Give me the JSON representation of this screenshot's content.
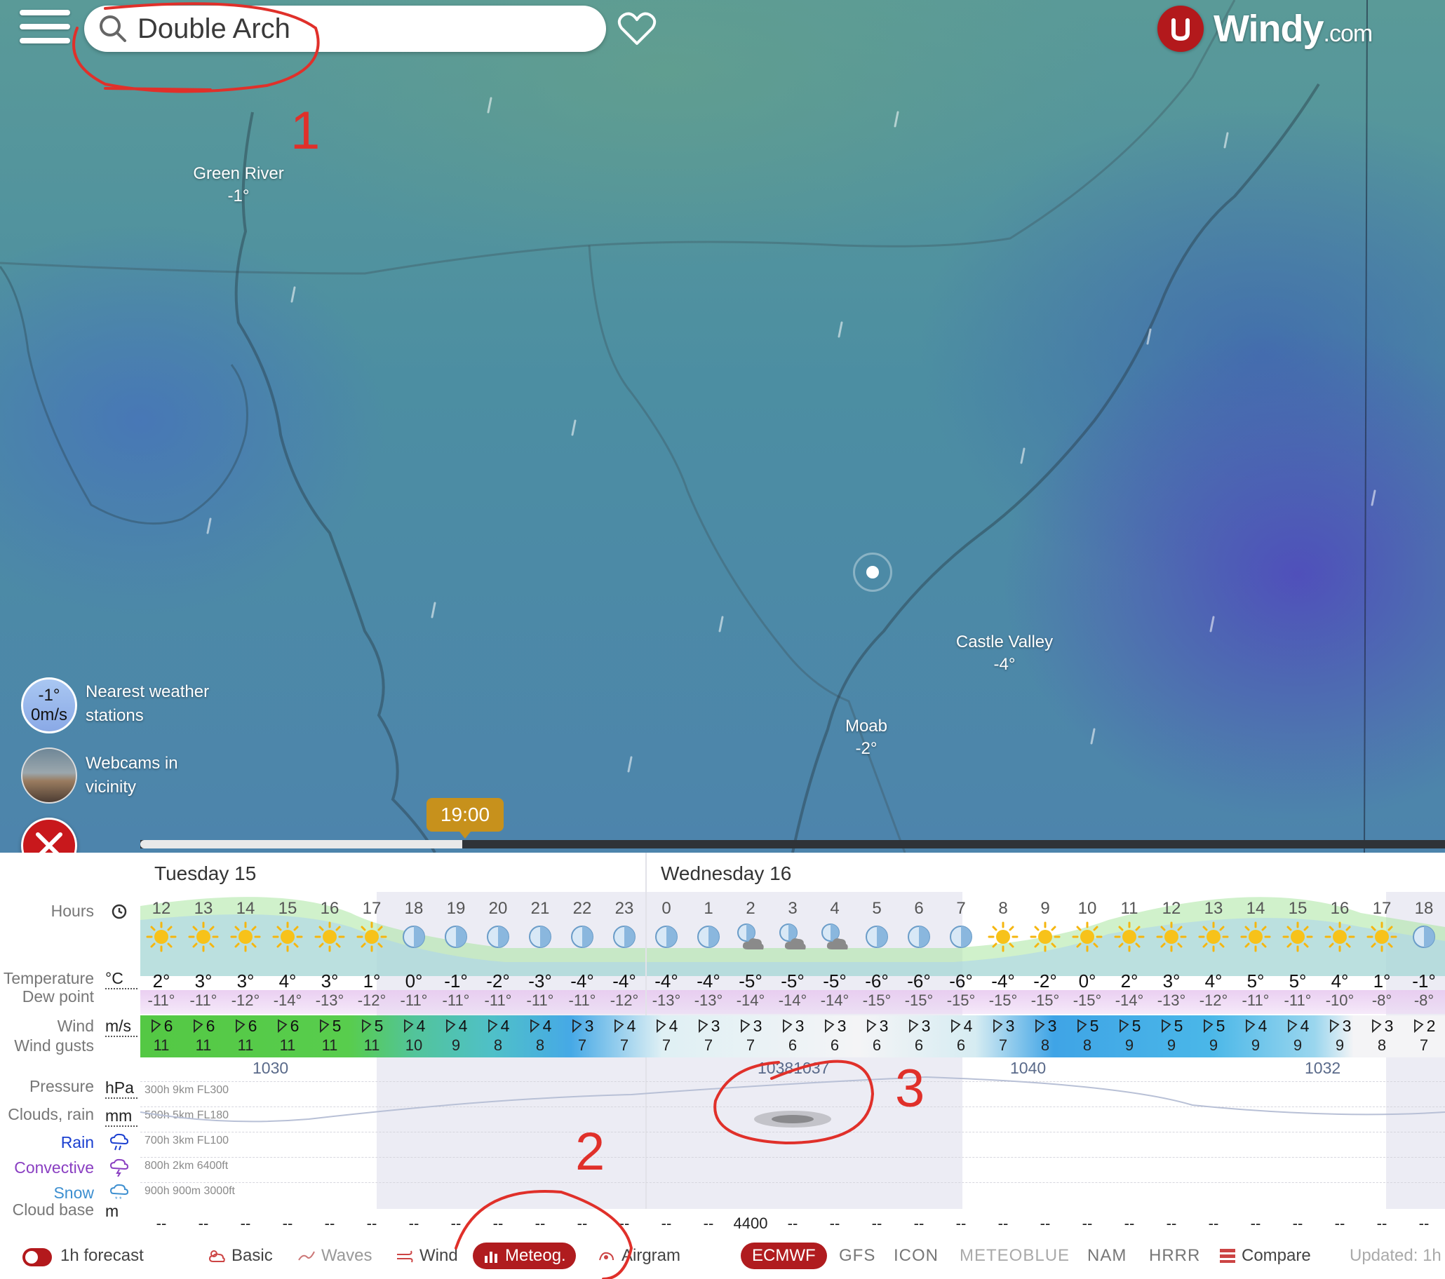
{
  "search": {
    "value": "Double Arch"
  },
  "logo": {
    "brand": "Windy",
    "suffix": ".com"
  },
  "map": {
    "places": [
      {
        "name": "Green River",
        "temp": "-1°"
      },
      {
        "name": "Castle Valley",
        "temp": "-4°"
      },
      {
        "name": "Moab",
        "temp": "-2°"
      }
    ],
    "station": {
      "temp": "-1°",
      "wind": "0m/s",
      "label_line1": "Nearest weather",
      "label_line2": "stations"
    },
    "webcams": {
      "label_line1": "Webcams in",
      "label_line2": "vicinity"
    },
    "timeline": {
      "current_time": "19:00",
      "progress": 0.247
    }
  },
  "forecast": {
    "days": [
      "Tuesday 15",
      "Wednesday 16"
    ],
    "row_labels": {
      "hours": "Hours",
      "temperature": "Temperature",
      "temperature_unit": "°C",
      "dew_point": "Dew point",
      "wind": "Wind",
      "wind_unit": "m/s",
      "wind_gusts": "Wind gusts",
      "pressure": "Pressure",
      "pressure_unit": "hPa",
      "clouds": "Clouds, rain",
      "clouds_unit": "mm",
      "rain": "Rain",
      "convective": "Convective",
      "snow": "Snow",
      "cloud_base": "Cloud base",
      "cloud_base_unit": "m"
    },
    "row_colors": {
      "rain": "#1a3fd0",
      "convective": "#8a3fc2",
      "snow": "#3d8fd0"
    },
    "hours": [
      "12",
      "13",
      "14",
      "15",
      "16",
      "17",
      "18",
      "19",
      "20",
      "21",
      "22",
      "23",
      "0",
      "1",
      "2",
      "3",
      "4",
      "5",
      "6",
      "7",
      "8",
      "9",
      "10",
      "11",
      "12",
      "13",
      "14",
      "15",
      "16",
      "17",
      "18"
    ],
    "icons": [
      "sun-icon",
      "sun-icon",
      "sun-icon",
      "sun-icon",
      "sun-icon",
      "sun-icon",
      "moon-icon",
      "moon-icon",
      "moon-icon",
      "moon-icon",
      "moon-icon",
      "moon-icon",
      "moon-icon",
      "moon-icon",
      "moon-cloud-icon",
      "moon-cloud-icon",
      "moon-cloud-icon",
      "moon-icon",
      "moon-icon",
      "moon-icon",
      "sun-icon",
      "sun-icon",
      "sun-icon",
      "sun-icon",
      "sun-icon",
      "sun-icon",
      "sun-icon",
      "sun-icon",
      "sun-icon",
      "sun-icon",
      "moon-icon"
    ],
    "temperatures": [
      "2°",
      "3°",
      "3°",
      "4°",
      "3°",
      "1°",
      "0°",
      "-1°",
      "-2°",
      "-3°",
      "-4°",
      "-4°",
      "-4°",
      "-4°",
      "-5°",
      "-5°",
      "-5°",
      "-6°",
      "-6°",
      "-6°",
      "-4°",
      "-2°",
      "0°",
      "2°",
      "3°",
      "4°",
      "5°",
      "5°",
      "4°",
      "1°",
      "-1°"
    ],
    "dew_points": [
      "-11°",
      "-11°",
      "-12°",
      "-14°",
      "-13°",
      "-12°",
      "-11°",
      "-11°",
      "-11°",
      "-11°",
      "-11°",
      "-12°",
      "-13°",
      "-13°",
      "-14°",
      "-14°",
      "-14°",
      "-15°",
      "-15°",
      "-15°",
      "-15°",
      "-15°",
      "-15°",
      "-14°",
      "-13°",
      "-12°",
      "-11°",
      "-11°",
      "-10°",
      "-8°",
      "-8°"
    ],
    "wind_speeds": [
      "6",
      "6",
      "6",
      "6",
      "5",
      "5",
      "4",
      "4",
      "4",
      "4",
      "3",
      "4",
      "4",
      "3",
      "3",
      "3",
      "3",
      "3",
      "3",
      "4",
      "3",
      "3",
      "5",
      "5",
      "5",
      "5",
      "4",
      "4",
      "3",
      "3",
      "2"
    ],
    "wind_gusts": [
      "11",
      "11",
      "11",
      "11",
      "11",
      "11",
      "10",
      "9",
      "8",
      "8",
      "7",
      "7",
      "7",
      "7",
      "7",
      "6",
      "6",
      "6",
      "6",
      "6",
      "7",
      "8",
      "8",
      "9",
      "9",
      "9",
      "9",
      "9",
      "9",
      "8",
      "7"
    ],
    "pressure_labels": [
      {
        "hour_index": 3,
        "text": "1030"
      },
      {
        "hour_index": 15,
        "text": "10381037"
      },
      {
        "hour_index": 21,
        "text": "1040"
      },
      {
        "hour_index": 28,
        "text": "1032"
      }
    ],
    "altitude_levels": [
      "300h 9km FL300",
      "500h 5km FL180",
      "700h 3km FL100",
      "800h 2km 6400ft",
      "900h 900m 3000ft"
    ],
    "cloud_base": [
      "--",
      "--",
      "--",
      "--",
      "--",
      "--",
      "--",
      "--",
      "--",
      "--",
      "--",
      "--",
      "--",
      "--",
      "4400",
      "--",
      "--",
      "--",
      "--",
      "--",
      "--",
      "--",
      "--",
      "--",
      "--",
      "--",
      "--",
      "--",
      "--",
      "--",
      "--"
    ]
  },
  "bottombar": {
    "toggle_label": "1h forecast",
    "tabs": [
      {
        "label": "Basic",
        "icon": "cloud-sun-icon"
      },
      {
        "label": "Waves",
        "icon": "waves-icon"
      },
      {
        "label": "Wind",
        "icon": "wind-icon"
      },
      {
        "label": "Meteog.",
        "icon": "bar-chart-icon"
      },
      {
        "label": "Airgram",
        "icon": "airgram-icon"
      }
    ],
    "models": [
      "ECMWF",
      "GFS",
      "ICON",
      "METEOBLUE",
      "NAM",
      "HRRR"
    ],
    "compare": "Compare",
    "updated": "Updated: 1h"
  },
  "annotations": [
    "1",
    "2",
    "3"
  ],
  "colors": {
    "brand_red": "#b3191c",
    "timeline_badge": "#c7911c",
    "annotation_red": "#e0302a"
  }
}
